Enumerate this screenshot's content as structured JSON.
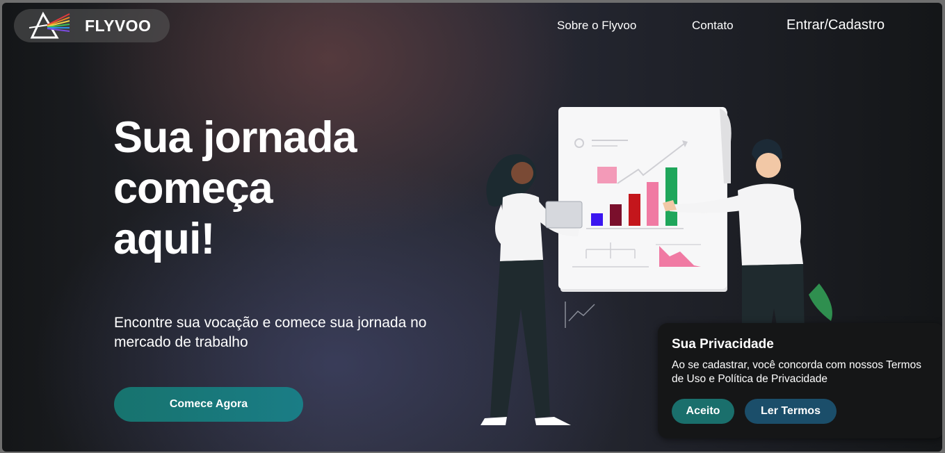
{
  "brand": {
    "name": "FLYVOO",
    "logo_icon": "prism-icon"
  },
  "nav": {
    "about": "Sobre o Flyvoo",
    "contact": "Contato",
    "login": "Entrar/Cadastro"
  },
  "hero": {
    "title_line1": "Sua jornada",
    "title_line2": "começa",
    "title_line3": "aqui!",
    "subtitle": "Encontre sua vocação e comece sua jornada no mercado de trabalho",
    "cta": "Comece Agora"
  },
  "privacy": {
    "title": "Sua Privacidade",
    "text": "Ao se cadastrar, você concorda com nossos Termos de Uso e Política de Privacidade",
    "accept": "Aceito",
    "read_terms": "Ler Termos"
  },
  "colors": {
    "cta": "#17736e",
    "accept": "#1a6f6c",
    "read_terms": "#1b4e6a",
    "bar_blue": "#3b16f0",
    "bar_maroon": "#7a0f2c",
    "bar_red": "#c4161c",
    "bar_pink": "#f07aa3",
    "bar_green": "#1fa65b"
  }
}
